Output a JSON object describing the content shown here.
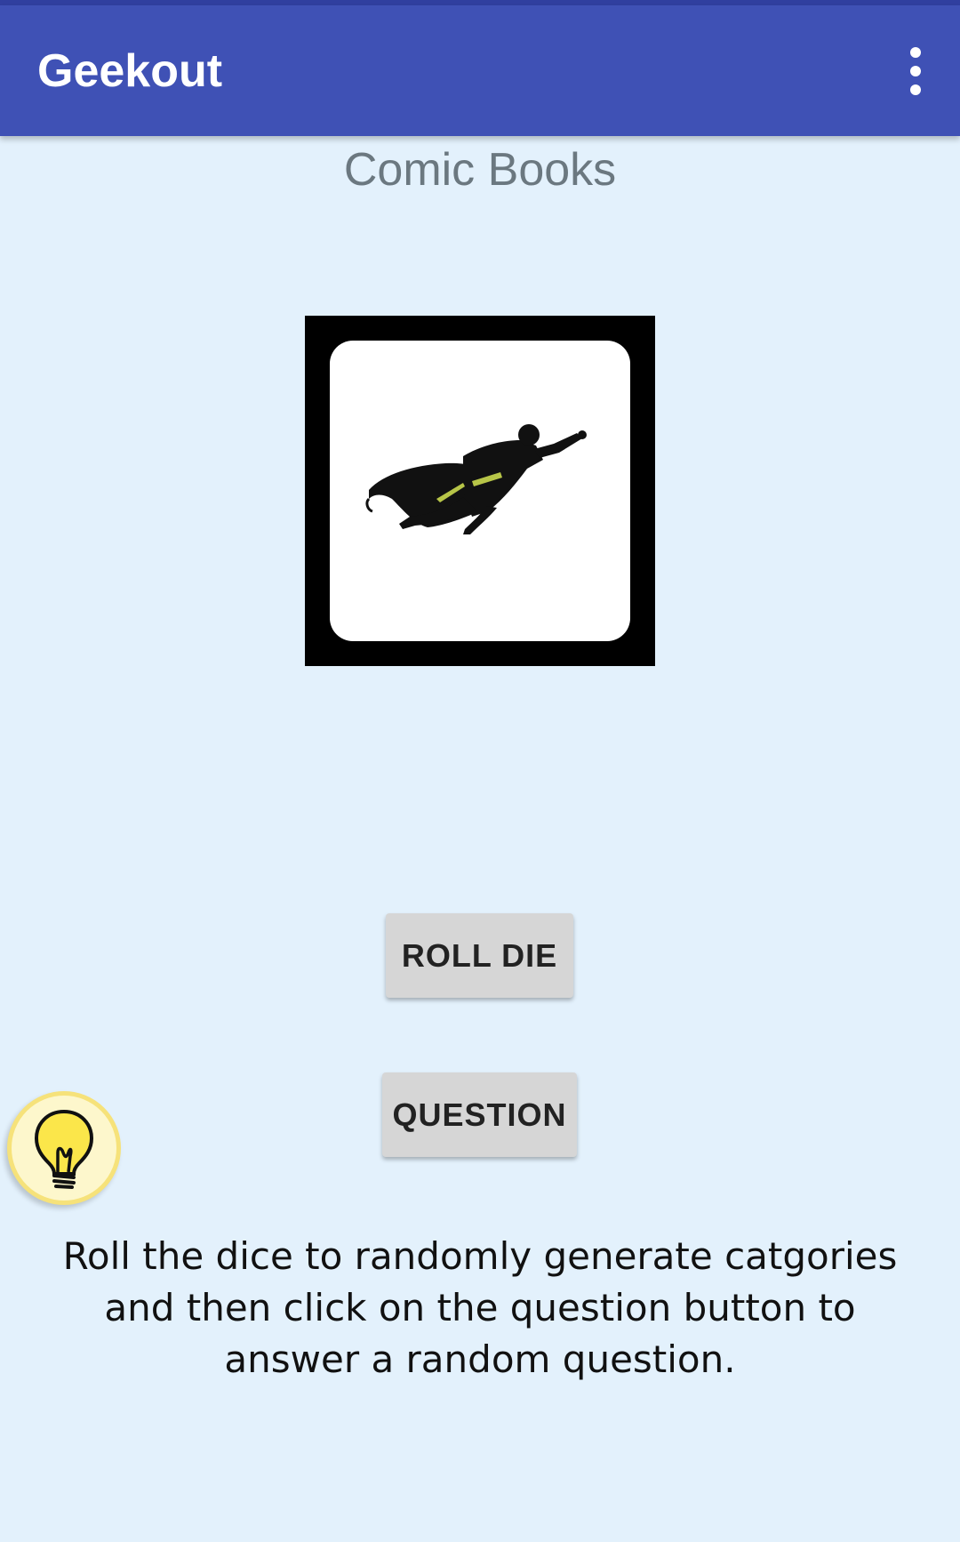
{
  "app_bar": {
    "title": "Geekout",
    "menu_icon": "more-vert-icon",
    "background_color": "#3f51b5"
  },
  "main": {
    "category_title": "Comic Books",
    "die_image": "flying-superhero-icon",
    "roll_button_label": "ROLL DIE",
    "question_button_label": "QUESTION",
    "hint_icon": "lightbulb-icon",
    "instructions": "Roll the dice to randomly generate catgories and then click on the question button to answer a random question."
  },
  "colors": {
    "background": "#e3f1fc",
    "button": "#d6d6d6",
    "hint": "#f6e27a"
  }
}
